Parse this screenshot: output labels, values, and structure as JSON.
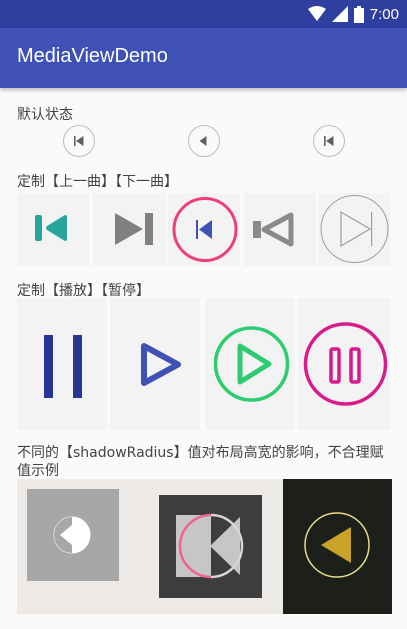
{
  "status": {
    "time": "7:00",
    "wifi_icon": "wifi-icon",
    "signal_icon": "signal-icon",
    "battery_icon": "battery-icon"
  },
  "appbar": {
    "title": "MediaViewDemo"
  },
  "sections": {
    "default_state": "默认状态",
    "custom_prev_next": "定制【上一曲】【下一曲】",
    "custom_play_pause": "定制【播放】【暂停】",
    "shadow_radius": "不同的【shadowRadius】值对布局高宽的影响，不合理赋值示例"
  },
  "colors": {
    "statusbar": "#2f3f9f",
    "appbar": "#3f51b5",
    "teal": "#26a69a",
    "gray": "#808080",
    "pink": "#ec407a",
    "blue": "#3f51b5",
    "navy": "#283593",
    "green": "#2ecc71",
    "magenta": "#d81b8c",
    "gold": "#c9a227"
  }
}
